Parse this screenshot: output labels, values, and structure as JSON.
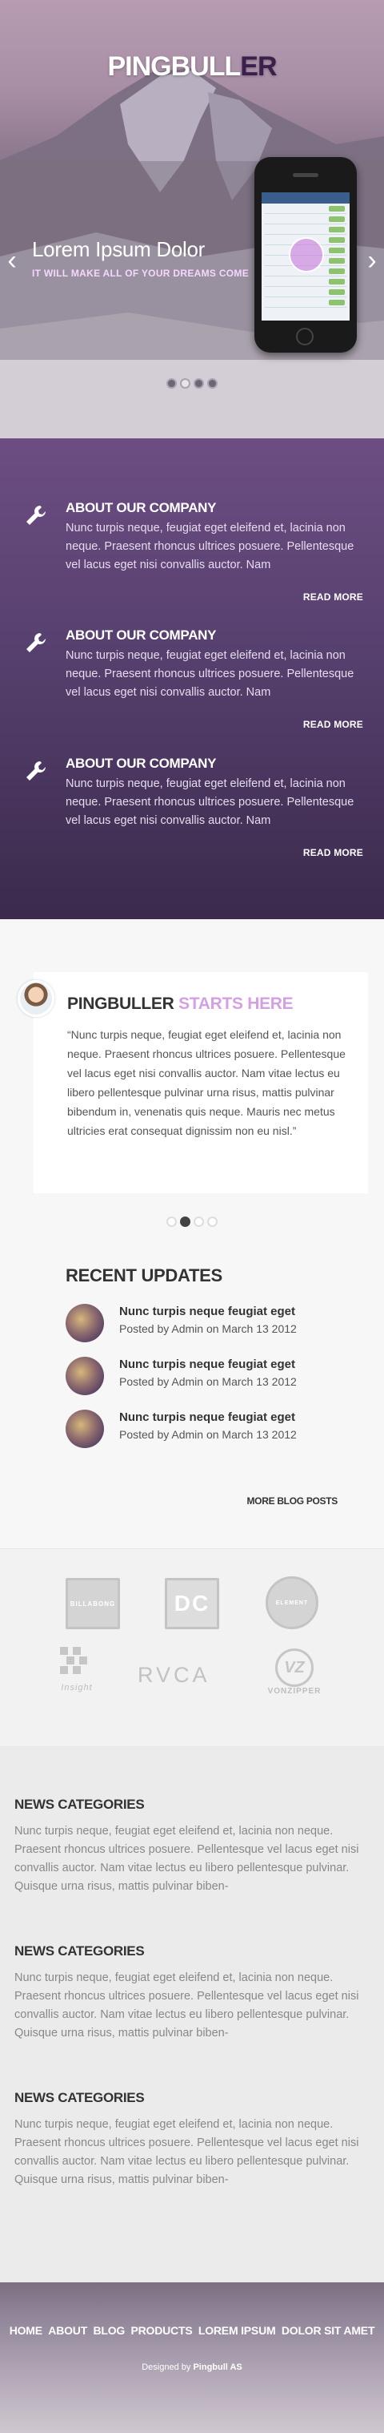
{
  "hero": {
    "logo_main": "PINGBULL",
    "logo_accent": "ER",
    "slide_title": "Lorem Ipsum Dolor",
    "slide_subtitle": "IT WILL MAKE ALL OF YOUR DREAMS COME",
    "prev_icon": "chevron-left-icon",
    "next_icon": "chevron-right-icon",
    "slide_count": 4,
    "active_slide": 2
  },
  "features": [
    {
      "title": "ABOUT OUR COMPANY",
      "text": "Nunc turpis neque, feugiat eget eleifend et, lacinia non neque. Praesent rhoncus ultrices posuere. Pellentesque vel lacus eget nisi convallis auctor. Nam",
      "more": "READ MORE",
      "icon": "wrench-icon"
    },
    {
      "title": "ABOUT OUR COMPANY",
      "text": "Nunc turpis neque, feugiat eget eleifend et, lacinia non neque. Praesent rhoncus ultrices posuere. Pellentesque vel lacus eget nisi convallis auctor. Nam",
      "more": "READ MORE",
      "icon": "wrench-icon"
    },
    {
      "title": "ABOUT OUR COMPANY",
      "text": "Nunc turpis neque, feugiat eget eleifend et, lacinia non neque. Praesent rhoncus ultrices posuere. Pellentesque vel lacus eget nisi convallis auctor. Nam",
      "more": "READ MORE",
      "icon": "wrench-icon"
    }
  ],
  "testimonial": {
    "title_main": "PINGBULLER",
    "title_accent": "STARTS HERE",
    "quote": "“Nunc turpis neque, feugiat eget eleifend et, lacinia non neque. Praesent rhoncus ultrices posuere. Pellentesque vel lacus eget nisi convallis auctor. Nam vitae lectus eu libero pellentesque pulvinar urna risus, mattis pulvinar bibendum in, venenatis quis neque. Mauris nec metus ultricies erat consequat dignissim non eu nisl.”",
    "dot_count": 4,
    "active_dot": 2
  },
  "recent_updates": {
    "title": "RECENT UPDATES",
    "posts": [
      {
        "title": "Nunc turpis neque feugiat eget",
        "meta": "Posted by Admin on March 13 2012"
      },
      {
        "title": "Nunc turpis neque feugiat eget",
        "meta": "Posted by Admin on March 13 2012"
      },
      {
        "title": "Nunc turpis neque feugiat eget",
        "meta": "Posted by Admin on March 13 2012"
      }
    ],
    "more": "MORE BLOG POSTS"
  },
  "brands": [
    {
      "name": "BILLABONG",
      "icon": "billabong-logo"
    },
    {
      "name": "DC",
      "icon": "dc-logo"
    },
    {
      "name": "ELEMENT",
      "icon": "element-logo"
    },
    {
      "name": "Insight",
      "icon": "insight-logo"
    },
    {
      "name": "RVCA",
      "icon": "rvca-logo"
    },
    {
      "name": "VONZIPPER",
      "icon": "vonzipper-logo"
    }
  ],
  "news": [
    {
      "title": "NEWS CATEGORIES",
      "text": "Nunc turpis neque, feugiat eget eleifend et, lacinia non neque. Praesent rhoncus ultrices posuere. Pellentesque vel lacus eget nisi convallis auctor. Nam vitae lectus eu libero pellentesque pulvinar. Quisque urna risus, mattis pulvinar biben-"
    },
    {
      "title": "NEWS CATEGORIES",
      "text": "Nunc turpis neque, feugiat eget eleifend et, lacinia non neque. Praesent rhoncus ultrices posuere. Pellentesque vel lacus eget nisi convallis auctor. Nam vitae lectus eu libero pellentesque pulvinar. Quisque urna risus, mattis pulvinar biben-"
    },
    {
      "title": "NEWS CATEGORIES",
      "text": "Nunc turpis neque, feugiat eget eleifend et, lacinia non neque. Praesent rhoncus ultrices posuere. Pellentesque vel lacus eget nisi convallis auctor. Nam vitae lectus eu libero pellentesque pulvinar. Quisque urna risus, mattis pulvinar biben-"
    }
  ],
  "footer": {
    "nav": [
      "HOME",
      "ABOUT",
      "BLOG",
      "PRODUCTS",
      "LOREM IPSUM",
      "DOLOR SIT AMET"
    ],
    "credit_prefix": "Designed by",
    "credit_name": "Pingbull AS"
  }
}
